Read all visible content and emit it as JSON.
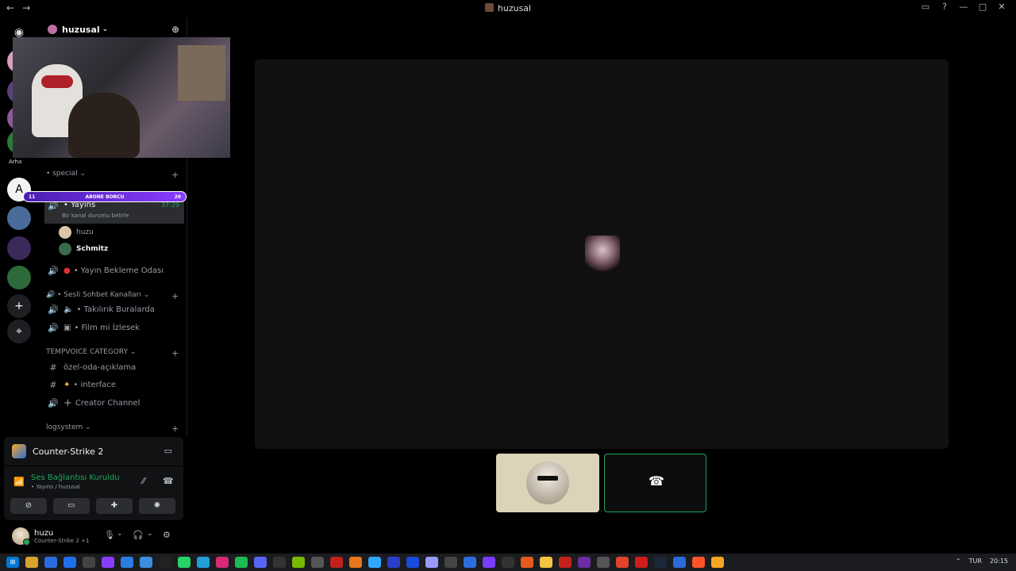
{
  "window": {
    "title": "huzusal",
    "back": "←",
    "forward": "→"
  },
  "server": {
    "name": "huzusal"
  },
  "overlay": {
    "left": "11",
    "label": "ABONE BORCU",
    "right": "20"
  },
  "categories": {
    "special": "• special",
    "sesli": "• Sesli Sohbet Kanalları",
    "tempvoice": "TEMPVOICE CATEGORY",
    "logsystem": "logsystem"
  },
  "channels": {
    "yayin": {
      "name": "• Yayıns",
      "time": "37:29",
      "status": "Bir kanal durumu belirle"
    },
    "users": [
      {
        "name": "huzu"
      },
      {
        "name": "Schmitz"
      }
    ],
    "bekleme": "• Yayın Bekleme Odası",
    "takilirik": "• Takılırık Buralarda",
    "film": "• Film mi İzlesek",
    "ozel": "özel-oda-açıklama",
    "interface": "• interface",
    "creator": "Creator Channel"
  },
  "rail": {
    "label_text": "Arha"
  },
  "game_panel": {
    "name": "Counter-Strike 2"
  },
  "voice_panel": {
    "status": "Ses Bağlantısı Kuruldu",
    "sub": "• Yayıns / huzusal"
  },
  "me": {
    "name": "huzu",
    "status": "Counter-Strike 2 +1"
  },
  "taskbar": {
    "lang": "TUR",
    "time": "20:15"
  },
  "colors": {
    "accent_green": "#23a55a",
    "bg": "#000000"
  }
}
